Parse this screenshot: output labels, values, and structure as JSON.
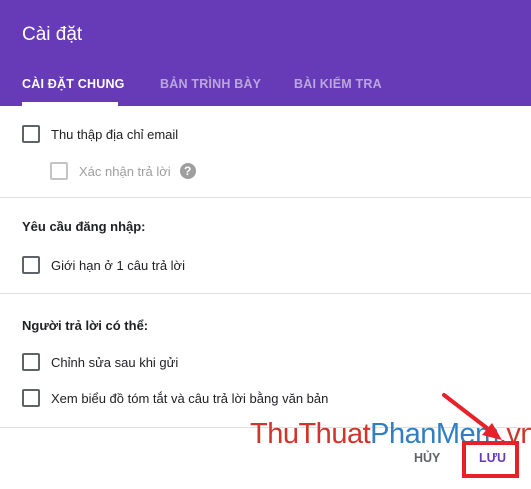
{
  "dialog": {
    "title": "Cài đặt",
    "tabs": [
      {
        "label": "CÀI ĐẶT CHUNG",
        "active": true
      },
      {
        "label": "BẢN TRÌNH BÀY",
        "active": false
      },
      {
        "label": "BÀI KIỂM TRA",
        "active": false
      }
    ]
  },
  "general": {
    "collect_email": {
      "label": "Thu thập địa chỉ email",
      "checked": false
    },
    "response_receipts": {
      "label": "Xác nhận trả lời",
      "checked": false,
      "disabled": true,
      "help_icon": "help-icon"
    },
    "login_section": {
      "title": "Yêu cầu đăng nhập:",
      "limit_one": {
        "label": "Giới hạn ở 1 câu trả lời",
        "checked": false
      }
    },
    "respondents_section": {
      "title": "Người trả lời có thể:",
      "edit_after": {
        "label": "Chỉnh sửa sau khi gửi",
        "checked": false
      },
      "see_summary": {
        "label": "Xem biểu đồ tóm tắt và câu trả lời bằng văn bản",
        "checked": false
      }
    }
  },
  "footer": {
    "cancel_label": "HỦY",
    "save_label": "LƯU"
  },
  "overlay": {
    "watermark_part1": "ThuThuat",
    "watermark_part2": "PhanMem",
    "watermark_part3": ".vn",
    "highlight_color": "#e8202a"
  },
  "colors": {
    "header_bg": "#673ab7",
    "accent": "#673ab7"
  }
}
